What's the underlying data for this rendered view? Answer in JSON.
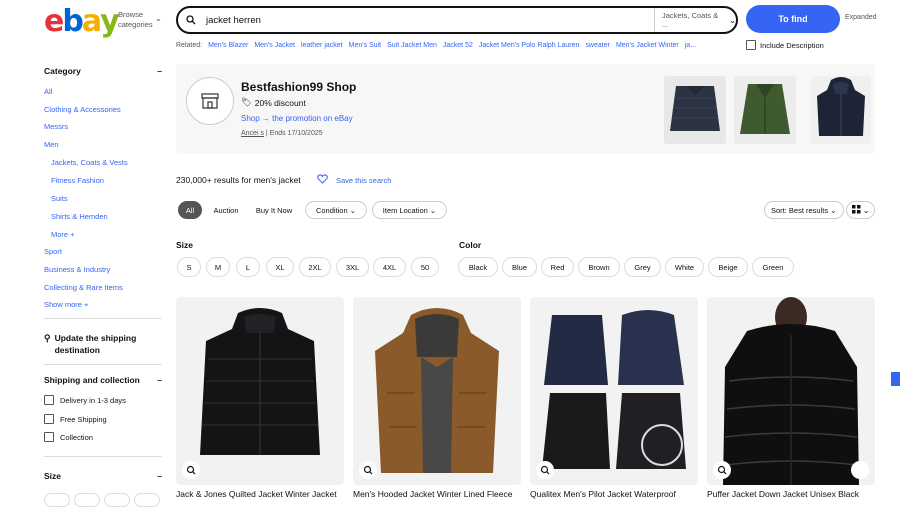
{
  "header": {
    "logo": [
      "e",
      "b",
      "a",
      "y"
    ],
    "logo_colors": [
      "#e53238",
      "#0064d2",
      "#f5af02",
      "#86b817"
    ],
    "browse_label": "Browse categories",
    "search_query": "jacket herren",
    "search_category": "Jackets, Coats & ...",
    "find_button": "To find",
    "expanded_label": "Expanded"
  },
  "related": {
    "label": "Related:",
    "items": [
      "Men's Blazer",
      "Men's Jacket",
      "leather jacket",
      "Men's Suit",
      "Suit Jacket Men",
      "Jacket 52",
      "Jacket Men's Polo Ralph Lauren",
      "sweater",
      "Men's Jacket Winter",
      "ja..."
    ],
    "include_description": "Include Description"
  },
  "sidebar": {
    "category_title": "Category",
    "category_items": [
      {
        "label": "All",
        "level": 0
      },
      {
        "label": "Clothing & Accessories",
        "level": 0
      },
      {
        "label": "Messrs",
        "level": 0
      },
      {
        "label": "Men",
        "level": 0
      },
      {
        "label": "Jackets, Coats & Vests",
        "level": 1
      },
      {
        "label": "Fitness Fashion",
        "level": 1
      },
      {
        "label": "Suits",
        "level": 1
      },
      {
        "label": "Shirts & Hemden",
        "level": 1
      },
      {
        "label": "More",
        "level": 1
      },
      {
        "label": "Sport",
        "level": 0
      },
      {
        "label": "Business & Industry",
        "level": 0
      },
      {
        "label": "Collecting & Rare Items",
        "level": 0
      },
      {
        "label": "Show more",
        "level": 0
      }
    ],
    "shipping_dest": "Update the shipping destination",
    "shipping_title": "Shipping and collection",
    "shipping_options": [
      "Delivery in 1-3 days",
      "Free Shipping",
      "Collection"
    ],
    "size_title": "Size"
  },
  "banner": {
    "shop_name": "Bestfashion99 Shop",
    "discount": "20% discount",
    "link": "Shop → the promotion on eBay",
    "seller": "Ancei s",
    "ends": "Ends 17/10/2025"
  },
  "results": {
    "count_text": "230,000+ results for men's jacket",
    "save_search": "Save this search"
  },
  "filters": {
    "tabs": [
      "All",
      "Auction",
      "Buy It Now"
    ],
    "dropdowns": [
      "Condition",
      "Item Location"
    ],
    "sort": "Sort: Best results"
  },
  "facets": {
    "size_title": "Size",
    "sizes": [
      "S",
      "M",
      "L",
      "XL",
      "2XL",
      "3XL",
      "4XL",
      "50"
    ],
    "color_title": "Color",
    "colors": [
      "Black",
      "Blue",
      "Red",
      "Brown",
      "Grey",
      "White",
      "Beige",
      "Green"
    ]
  },
  "items": [
    {
      "title": "Jack & Jones Quilted Jacket Winter Jacket"
    },
    {
      "title": "Men's Hooded Jacket Winter Lined Fleece"
    },
    {
      "title": "Qualitex Men's Pilot Jacket Waterproof"
    },
    {
      "title": "Puffer Jacket Down Jacket Unisex Black"
    }
  ]
}
